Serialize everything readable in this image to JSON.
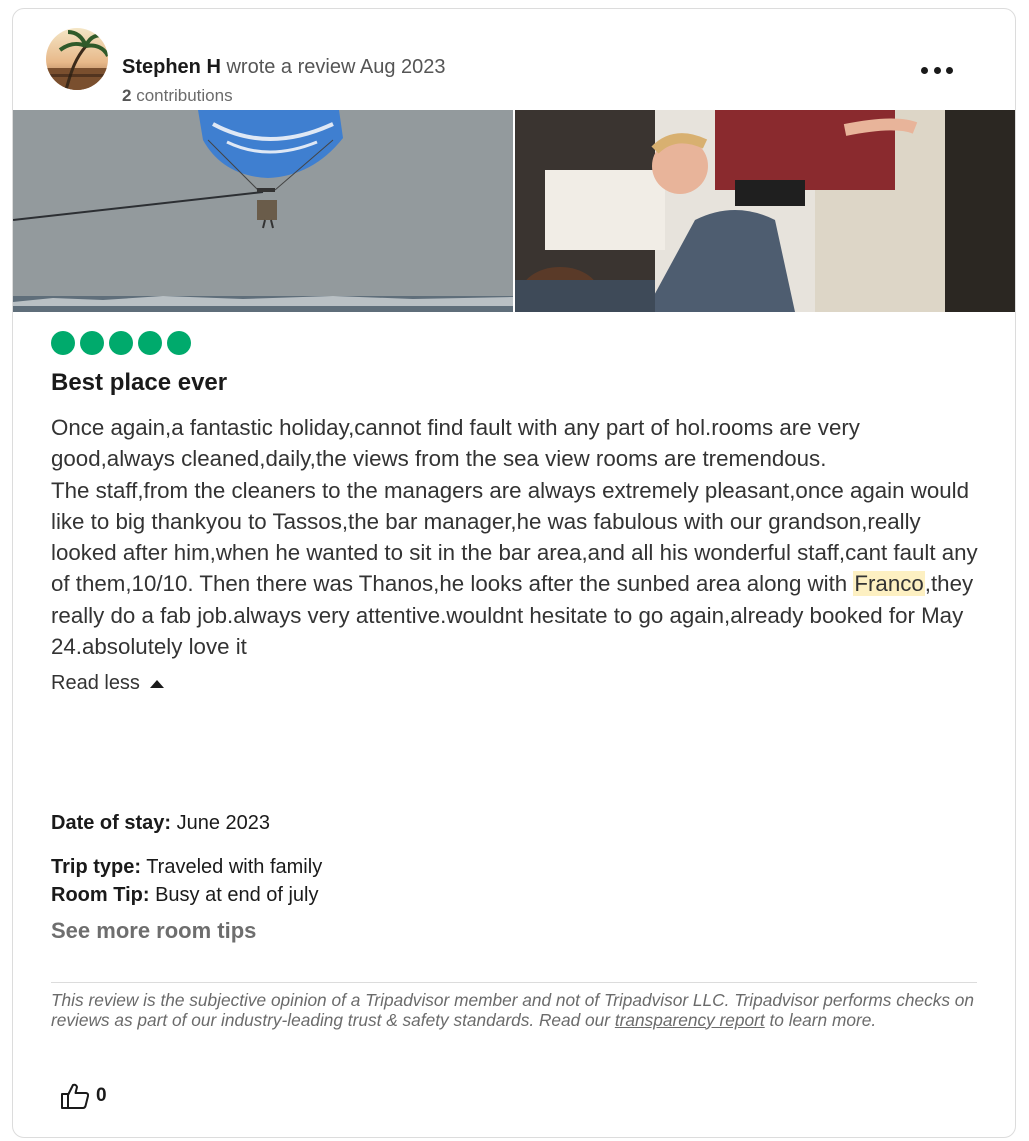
{
  "review": {
    "author_name": "Stephen H",
    "action_text": " wrote a review Aug 2023",
    "contributions_count": "2",
    "contributions_label": " contributions",
    "rating": 5,
    "title": "Best place ever",
    "text_before_highlight": "Once again,a fantastic holiday,cannot find fault with any part of hol.rooms are very good,always cleaned,daily,the views from the sea view rooms are tremendous.\nThe staff,from the cleaners to the managers are always extremely pleasant,once again would like to big thankyou to Tassos,the bar manager,he was fabulous with our grandson,really looked after him,when he wanted to sit in the bar area,and all his wonderful staff,cant fault any of them,10/10. Then there was Thanos,he looks after the sunbed area along with ",
    "highlight": "Franco",
    "text_after_highlight": ",they really do a fab job.always very attentive.wouldnt hesitate to go again,already booked for May 24.absolutely love it",
    "read_less_label": "Read less",
    "date_of_stay_label": "Date of stay:",
    "date_of_stay": " June 2023",
    "trip_type_label": "Trip type:",
    "trip_type": " Traveled with family",
    "room_tip_label": "Room Tip:",
    "room_tip": " Busy at end of july",
    "see_more_room_tips": "See more room tips",
    "disclaimer_before_link": "This review is the subjective opinion of a Tripadvisor member and not of Tripadvisor LLC. Tripadvisor performs checks on reviews as part of our industry-leading trust & safety standards. Read our ",
    "disclaimer_link": "transparency report",
    "disclaimer_after_link": " to learn more.",
    "helpful_count": "0"
  },
  "icons": {
    "more": "more-options-icon",
    "thumbs_up": "thumbs-up-icon",
    "caret": "caret-up-icon"
  },
  "colors": {
    "rating_bubble": "#00aa6c",
    "highlight": "#fdf0c2"
  }
}
